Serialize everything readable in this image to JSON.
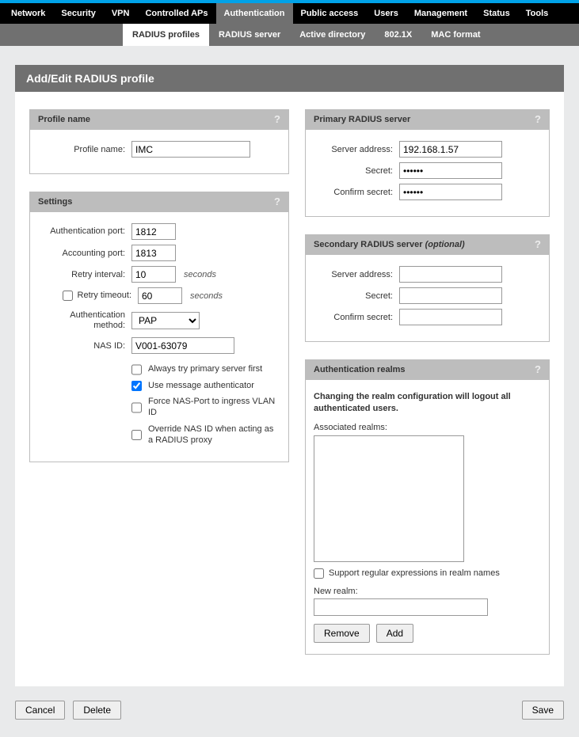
{
  "topnav": {
    "items": [
      "Network",
      "Security",
      "VPN",
      "Controlled APs",
      "Authentication",
      "Public access",
      "Users",
      "Management",
      "Status",
      "Tools"
    ],
    "active_index": 4
  },
  "subnav": {
    "items": [
      "RADIUS profiles",
      "RADIUS server",
      "Active directory",
      "802.1X",
      "MAC format"
    ],
    "active_index": 0
  },
  "page_title": "Add/Edit RADIUS profile",
  "profile": {
    "header": "Profile name",
    "label": "Profile name:",
    "value": "IMC"
  },
  "settings": {
    "header": "Settings",
    "auth_port_label": "Authentication port:",
    "auth_port": "1812",
    "acct_port_label": "Accounting port:",
    "acct_port": "1813",
    "retry_interval_label": "Retry interval:",
    "retry_interval": "10",
    "retry_interval_unit": "seconds",
    "retry_timeout_label": "Retry timeout:",
    "retry_timeout_checked": false,
    "retry_timeout": "60",
    "retry_timeout_unit": "seconds",
    "auth_method_label": "Authentication method:",
    "auth_method": "PAP",
    "nas_id_label": "NAS ID:",
    "nas_id": "V001-63079",
    "checks": [
      {
        "label": "Always try primary server first",
        "checked": false
      },
      {
        "label": "Use message authenticator",
        "checked": true
      },
      {
        "label": "Force NAS-Port to ingress VLAN ID",
        "checked": false
      },
      {
        "label": "Override NAS ID when acting as a RADIUS proxy",
        "checked": false
      }
    ]
  },
  "primary": {
    "header": "Primary RADIUS server",
    "addr_label": "Server address:",
    "addr": "192.168.1.57",
    "secret_label": "Secret:",
    "secret": "••••••",
    "confirm_label": "Confirm secret:",
    "confirm": "••••••"
  },
  "secondary": {
    "header": "Secondary RADIUS server ",
    "header_suffix": "(optional)",
    "addr_label": "Server address:",
    "addr": "",
    "secret_label": "Secret:",
    "secret": "",
    "confirm_label": "Confirm secret:",
    "confirm": ""
  },
  "realms": {
    "header": "Authentication realms",
    "warning": "Changing the realm configuration will logout all authenticated users.",
    "assoc_label": "Associated realms:",
    "support_regex_label": "Support regular expressions in realm names",
    "support_regex_checked": false,
    "new_realm_label": "New realm:",
    "new_realm_value": "",
    "remove_btn": "Remove",
    "add_btn": "Add"
  },
  "footer": {
    "cancel": "Cancel",
    "delete": "Delete",
    "save": "Save"
  },
  "help_icon": "?"
}
